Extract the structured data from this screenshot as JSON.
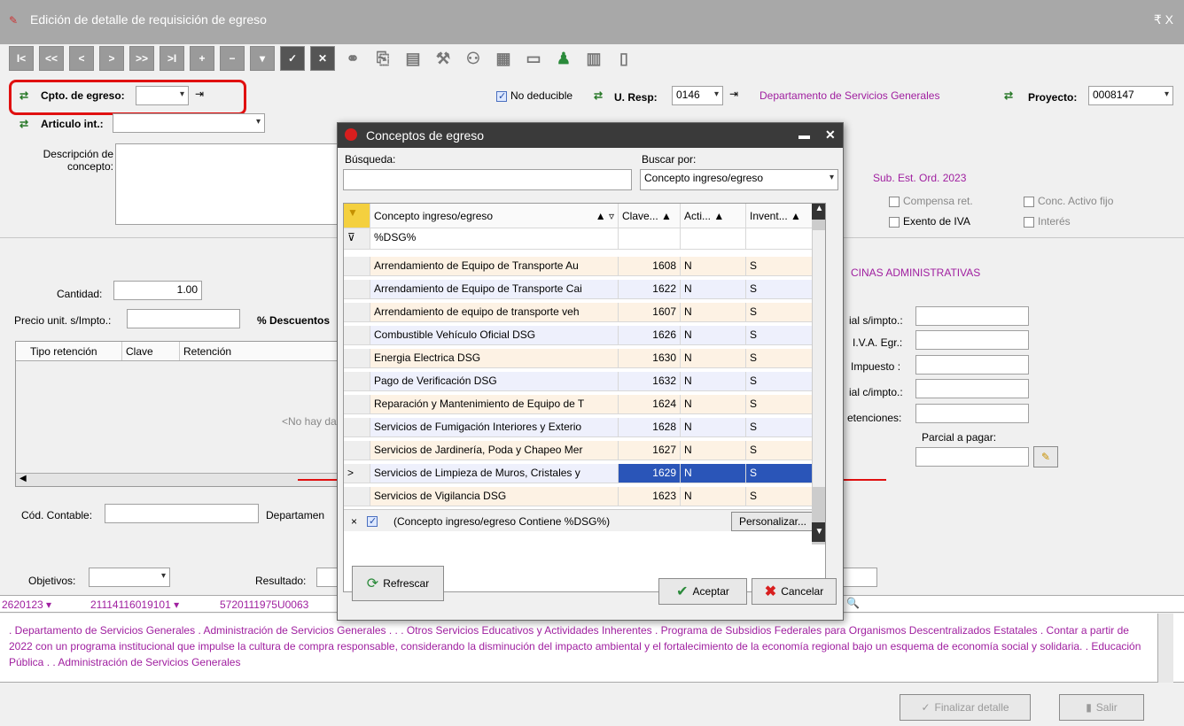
{
  "window": {
    "title": "Edición de detalle de requisición de egreso",
    "controls": "₹  X"
  },
  "toolbar": {
    "first": "I<",
    "prev2": "<<",
    "prev": "<",
    "next": ">",
    "next2": ">>",
    "last": ">I",
    "add": "+",
    "remove": "−",
    "down": "▾",
    "ok": "✓",
    "close": "✕"
  },
  "form": {
    "cpto_label": "Cpto. de egreso:",
    "articulo_label": "Articulo int.:",
    "descripcion_label": "Descripción de concepto:",
    "no_deducible": "No deducible",
    "uresp_label": "U. Resp:",
    "uresp_value": "0146",
    "uresp_desc": "Departamento de Servicios Generales",
    "proyecto_label": "Proyecto:",
    "proyecto_value": "0008147",
    "sub_est": "Sub. Est. Ord. 2023",
    "compensa": "Compensa ret.",
    "conc_activo": "Conc. Activo fijo",
    "exento": "Exento de IVA",
    "interes": "Interés",
    "oficinas": "CINAS ADMINISTRATIVAS",
    "cantidad_label": "Cantidad:",
    "cantidad_value": "1.00",
    "precio_label": "Precio unit. s/Impto.:",
    "descuentos_label": "% Descuentos",
    "ret_cols": [
      "Tipo retención",
      "Clave",
      "Retención"
    ],
    "no_data": "<No hay dat",
    "parcial_s": "ial s/impto.:",
    "iva": "I.V.A. Egr.:",
    "impuesto": "Impuesto :",
    "parcial_c": "ial c/impto.:",
    "retenciones": "etenciones:",
    "parcial_pagar": "Parcial a pagar:",
    "cod_contable": "Cód. Contable:",
    "departamento": "Departamen",
    "objetivos": "Objetivos:",
    "resultado": "Resultado:",
    "code1": "2620123",
    "code2": "21114116019101",
    "code3": "5720111975U0063"
  },
  "bottom_text": ". Departamento de Servicios Generales . Administración de Servicios Generales . . . Otros Servicios Educativos y Actividades Inherentes . Programa de Subsidios Federales para Organismos Descentralizados Estatales . Contar a partir de 2022 con un programa institucional que impulse la cultura de compra responsable, considerando la disminución del impacto ambiental y el fortalecimiento de la economía regional bajo un esquema de economía social y solidaria. . Educación Pública . . Administración de Servicios Generales",
  "footer": {
    "finalizar": "Finalizar detalle",
    "salir": "Salir"
  },
  "dialog": {
    "title": "Conceptos de egreso",
    "busqueda_label": "Búsqueda:",
    "buscar_por_label": "Buscar por:",
    "buscar_por_value": "Concepto ingreso/egreso",
    "columns": [
      "Concepto ingreso/egreso",
      "Clave... ▲",
      "Acti... ▲",
      "Invent... ▲"
    ],
    "filter_value": "%DSG%",
    "rows": [
      {
        "concepto": "Arrendamiento de Equipo de Transporte Au",
        "clave": "1608",
        "acti": "N",
        "invent": "S"
      },
      {
        "concepto": "Arrendamiento de Equipo de Transporte Cai",
        "clave": "1622",
        "acti": "N",
        "invent": "S"
      },
      {
        "concepto": "Arrendamiento de equipo de transporte veh",
        "clave": "1607",
        "acti": "N",
        "invent": "S"
      },
      {
        "concepto": "Combustible Vehículo Oficial DSG",
        "clave": "1626",
        "acti": "N",
        "invent": "S"
      },
      {
        "concepto": "Energia Electrica DSG",
        "clave": "1630",
        "acti": "N",
        "invent": "S"
      },
      {
        "concepto": "Pago de Verificación DSG",
        "clave": "1632",
        "acti": "N",
        "invent": "S"
      },
      {
        "concepto": "Reparación y Mantenimiento de Equipo de T",
        "clave": "1624",
        "acti": "N",
        "invent": "S"
      },
      {
        "concepto": "Servicios de Fumigación Interiores y Exterio",
        "clave": "1628",
        "acti": "N",
        "invent": "S"
      },
      {
        "concepto": "Servicios de Jardinería, Poda y Chapeo Mer",
        "clave": "1627",
        "acti": "N",
        "invent": "S"
      },
      {
        "concepto": "Servicios de Limpieza de Muros, Cristales y",
        "clave": "1629",
        "acti": "N",
        "invent": "S"
      },
      {
        "concepto": "Servicios de Vigilancia DSG",
        "clave": "1623",
        "acti": "N",
        "invent": "S"
      }
    ],
    "filter_text": "(Concepto ingreso/egreso Contiene %DSG%)",
    "personalizar": "Personalizar...",
    "refrescar": "Refrescar",
    "aceptar": "Aceptar",
    "cancelar": "Cancelar"
  }
}
